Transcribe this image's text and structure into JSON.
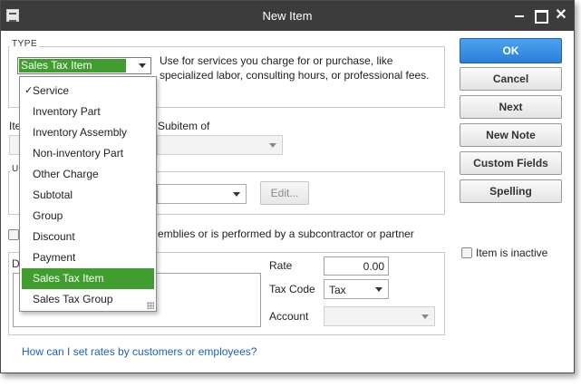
{
  "window": {
    "title": "New Item",
    "close_glyph": "✕"
  },
  "type_section": {
    "label": "TYPE",
    "selected_value": "Sales Tax Item",
    "description": "Use for services you charge for or purchase, like specialized labor, consulting hours, or professional fees."
  },
  "type_dropdown": {
    "items": [
      {
        "label": "Service",
        "checked": true
      },
      {
        "label": "Inventory Part"
      },
      {
        "label": "Inventory Assembly"
      },
      {
        "label": "Non-inventory Part"
      },
      {
        "label": "Other Charge"
      },
      {
        "label": "Subtotal"
      },
      {
        "label": "Group"
      },
      {
        "label": "Discount"
      },
      {
        "label": "Payment"
      },
      {
        "label": "Sales Tax Item",
        "highlighted": true
      },
      {
        "label": "Sales Tax Group"
      }
    ],
    "check_glyph": "✓"
  },
  "item_name": {
    "label_fragment": "Ite",
    "subitem_label": "Subitem of"
  },
  "unit_section": {
    "label_fragment": "U",
    "edit_label": "Edit..."
  },
  "subcontract": {
    "label_fragment": "emblies or is performed by a subcontractor or partner"
  },
  "description_section": {
    "label_fragment": "D"
  },
  "pricing": {
    "rate_label": "Rate",
    "rate_value": "0.00",
    "tax_code_label": "Tax Code",
    "tax_code_value": "Tax",
    "account_label": "Account",
    "account_value": ""
  },
  "help_link": "How can I set rates by customers or employees?",
  "buttons": {
    "ok": "OK",
    "cancel": "Cancel",
    "next": "Next",
    "new_note": "New Note",
    "custom_fields": "Custom Fields",
    "spelling": "Spelling"
  },
  "inactive": {
    "label": "Item is inactive"
  },
  "colors": {
    "highlight": "#3f9e2d",
    "primary_button": "#2a7fd8",
    "titlebar": "#3c3c3c",
    "link": "#1f5fbf"
  }
}
